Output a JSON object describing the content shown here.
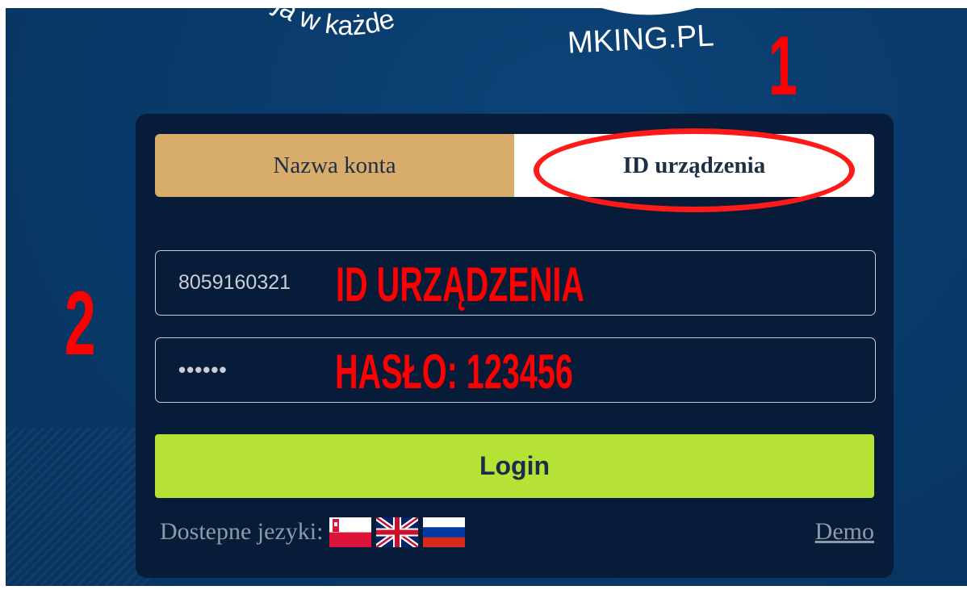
{
  "logo": {
    "left_slogan": "acja w każde",
    "right_brand": "MKING.PL"
  },
  "annotations": {
    "step1": "1",
    "step2": "2",
    "device_id_note": "ID URZĄDZENIA",
    "password_note": "HASŁO: 123456"
  },
  "tabs": {
    "account_label": "Nazwa konta",
    "device_label": "ID urządzenia",
    "active": "device"
  },
  "form": {
    "device_id_value": "8059160321",
    "password_masked": "••••••",
    "login_label": "Login"
  },
  "footer": {
    "languages_label": "Dostepne jezyki:",
    "flags": [
      "pl-flag-icon",
      "uk-flag-icon",
      "ru-flag-icon"
    ],
    "demo_label": "Demo"
  },
  "colors": {
    "background": "#093a6a",
    "panel": "#061c38",
    "tab_inactive": "#d8ac6a",
    "tab_active": "#ffffff",
    "login_button": "#b5e234",
    "annotation_red": "#ff0000"
  }
}
